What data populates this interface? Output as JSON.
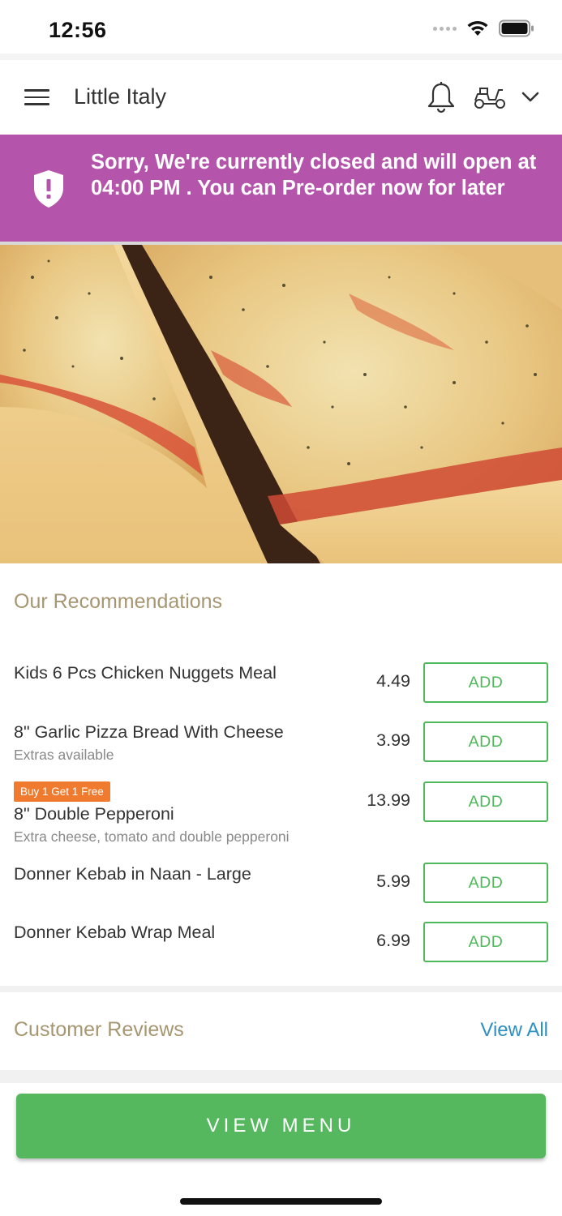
{
  "status_bar": {
    "time": "12:56"
  },
  "header": {
    "title": "Little Italy"
  },
  "banner": {
    "message": "Sorry, We're currently closed and will open at 04:00 PM . You can Pre-order now for later"
  },
  "recommendations": {
    "title": "Our Recommendations",
    "add_label": "ADD",
    "items": [
      {
        "name": "Kids 6 Pcs Chicken Nuggets Meal",
        "sub": "",
        "badge": "",
        "price": "4.49"
      },
      {
        "name": "8\" Garlic Pizza Bread With Cheese",
        "sub": "Extras available",
        "badge": "",
        "price": "3.99"
      },
      {
        "name": "8\" Double Pepperoni",
        "sub": "Extra cheese, tomato and double pepperoni",
        "badge": "Buy 1 Get 1 Free",
        "price": "13.99"
      },
      {
        "name": "Donner Kebab in Naan - Large",
        "sub": "",
        "badge": "",
        "price": "5.99"
      },
      {
        "name": "Donner Kebab Wrap Meal",
        "sub": "",
        "badge": "",
        "price": "6.99"
      }
    ]
  },
  "reviews": {
    "title": "Customer Reviews",
    "view_all": "View All"
  },
  "footer": {
    "view_menu": "VIEW MENU"
  },
  "colors": {
    "banner": "#b455ab",
    "accent_green": "#4fb85a",
    "promo_orange": "#f07a2e",
    "section_title": "#a69672",
    "link_blue": "#2e8fc3"
  }
}
